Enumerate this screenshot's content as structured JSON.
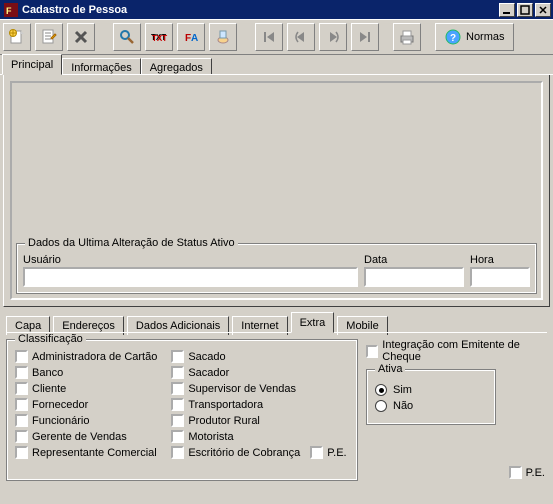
{
  "window": {
    "title": "Cadastro de Pessoa"
  },
  "toolbar": {
    "normas": "Normas"
  },
  "topTabs": {
    "principal": "Principal",
    "informacoes": "Informações",
    "agregados": "Agregados"
  },
  "statusGroup": {
    "legend": "Dados da Ultima Alteração de Status Ativo",
    "usuario_label": "Usuário",
    "data_label": "Data",
    "hora_label": "Hora",
    "usuario_value": "",
    "data_value": "",
    "hora_value": ""
  },
  "subTabs": {
    "capa": "Capa",
    "enderecos": "Endereços",
    "dados": "Dados Adicionais",
    "internet": "Internet",
    "extra": "Extra",
    "mobile": "Mobile"
  },
  "classification": {
    "legend": "Classificação",
    "col1": {
      "admin_cartao": "Administradora de Cartão",
      "banco": "Banco",
      "cliente": "Cliente",
      "fornecedor": "Fornecedor",
      "funcionario": "Funcionário",
      "gerente": "Gerente de Vendas",
      "representante": "Representante Comercial"
    },
    "col2": {
      "sacado": "Sacado",
      "sacador": "Sacador",
      "supervisor": "Supervisor de Vendas",
      "transportadora": "Transportadora",
      "produtor": "Produtor Rural",
      "motorista": "Motorista",
      "escritorio": "Escritório de Cobrança"
    },
    "pe": "P.E."
  },
  "right": {
    "integracao": "Integração com Emitente de Cheque",
    "ativa_legend": "Ativa",
    "sim": "Sim",
    "nao": "Não",
    "pe": "P.E."
  }
}
